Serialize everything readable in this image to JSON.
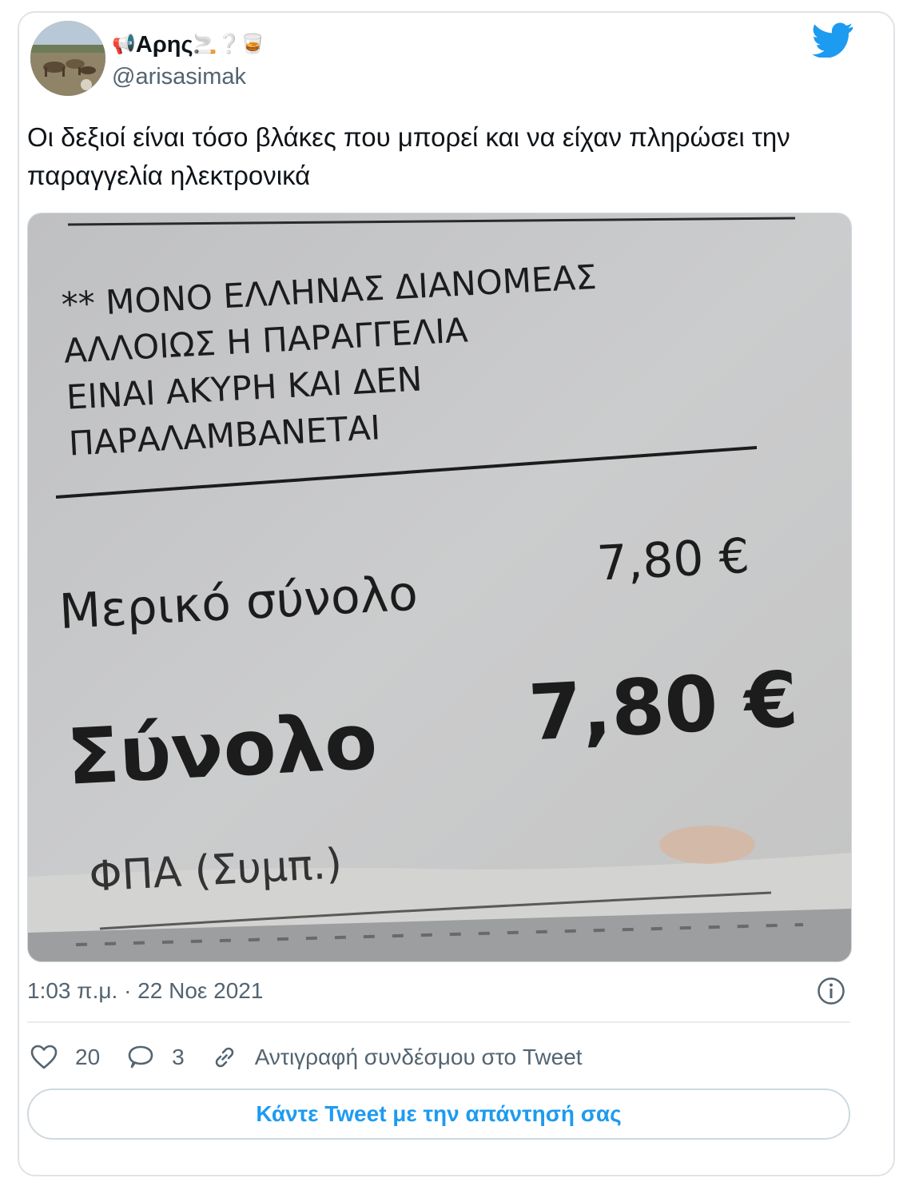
{
  "author": {
    "display_name": "Αρης",
    "name_emoji_before": "📢",
    "name_emoji_after": "🚬❔🥃",
    "handle": "@arisasimak"
  },
  "tweet": {
    "text": "Οι δεξιοί είναι τόσο βλάκες που μπορεί και να είχαν πληρώσει την παραγγελία ηλεκτρονικά",
    "timestamp": "1:03 π.μ. · 22 Νοε 2021"
  },
  "receipt": {
    "notice_lines": [
      "** ΜΟΝΟ ΕΛΛΗΝΑΣ ΔΙΑΝΟΜΕΑΣ",
      "ΑΛΛΟΙΩΣ Η ΠΑΡΑΓΓΕΛΙΑ",
      "ΕΙΝΑΙ ΑΚΥΡΗ ΚΑΙ ΔΕΝ",
      "ΠΑΡΑΛΑΜΒΑΝΕΤΑΙ"
    ],
    "subtotal_label": "Μερικό σύνολο",
    "subtotal_value": "7,80 €",
    "total_label": "Σύνολο",
    "total_value": "7,80 €",
    "vat_label": "ΦΠΑ (Συμπ.)"
  },
  "actions": {
    "likes": "20",
    "replies": "3",
    "copy_link_label": "Αντιγραφή συνδέσμου στο Tweet",
    "reply_button_label": "Κάντε Tweet με την απάντησή σας"
  },
  "colors": {
    "accent": "#1d9bf0",
    "secondary_text": "#536471",
    "border": "#cfd9de"
  },
  "icons": [
    "twitter-bird-icon",
    "info-icon",
    "heart-icon",
    "reply-icon",
    "link-icon"
  ]
}
